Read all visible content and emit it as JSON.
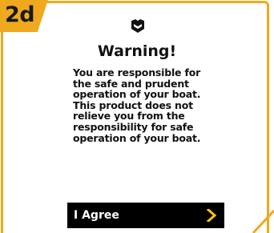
{
  "step": {
    "label": "2d"
  },
  "dialog": {
    "title": "Warning!",
    "body": "You are responsible for\nthe safe and prudent\noperation of your boat.\nThis product does not\nrelieve you from the\nresponsibility for safe\noperation of your boat.",
    "agree_button_label": "I Agree"
  },
  "icons": {
    "brand": "brand-logo-icon",
    "agree_arrow": "chevron-right-icon"
  },
  "colors": {
    "accent": "#f0a91e",
    "button_bg": "#000000",
    "button_text": "#ffffff",
    "arrow": "#f5c518",
    "text": "#111111"
  }
}
